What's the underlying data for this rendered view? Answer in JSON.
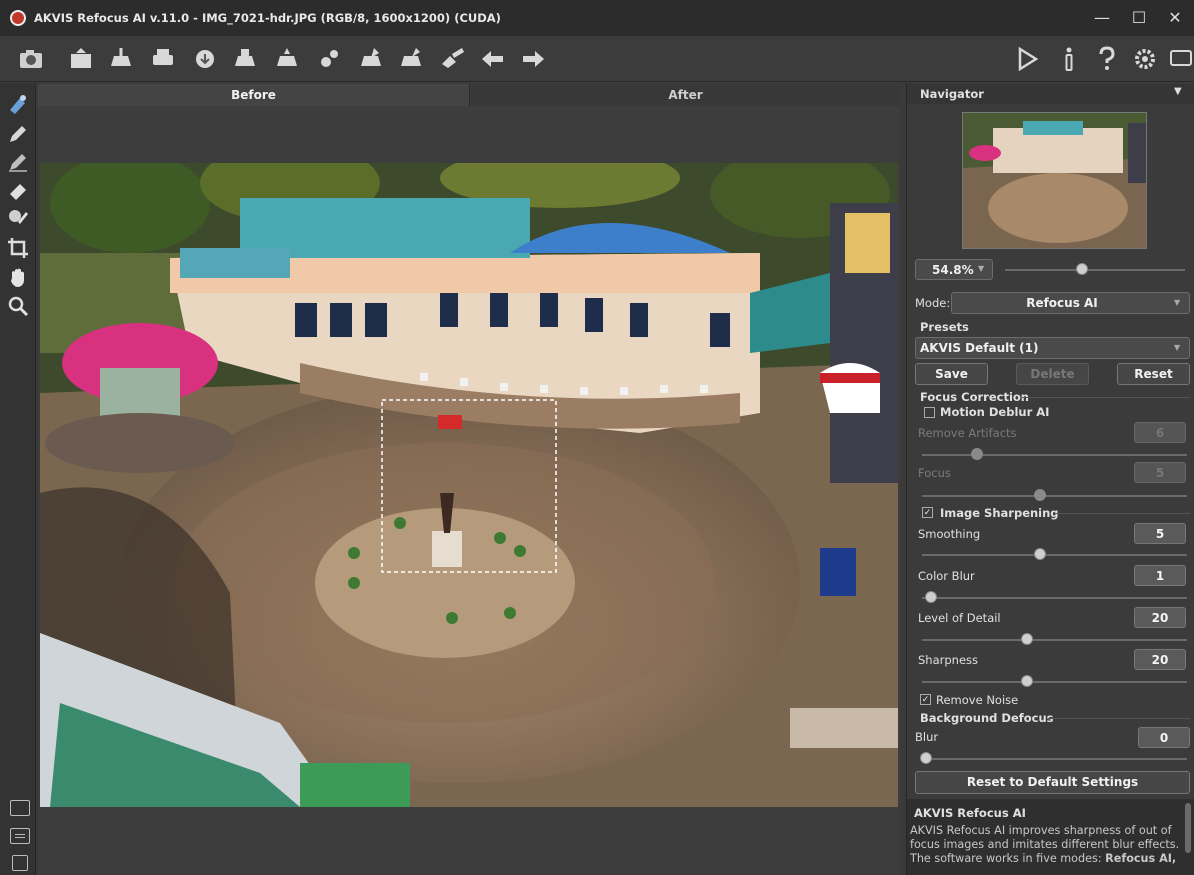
{
  "window": {
    "title": "AKVIS Refocus AI v.11.0 - IMG_7021-hdr.JPG (RGB/8, 1600x1200) (CUDA)",
    "minimize": "—",
    "maximize": "☐",
    "close": "✕"
  },
  "toolbar": {
    "icons": [
      "camera-icon",
      "open-icon",
      "save-icon",
      "print-icon",
      "share-icon",
      "batch-icon",
      "plugin-icon",
      "settings-gear-icon",
      "upload-icon",
      "export-icon",
      "brush-icon",
      "undo-icon",
      "redo-icon"
    ],
    "right_icons": [
      "run-icon",
      "info-icon",
      "help-icon",
      "gear-icon",
      "message-icon"
    ]
  },
  "tabs": {
    "before": "Before",
    "after": "After"
  },
  "navigator": {
    "title": "Navigator",
    "zoom": "54.8%",
    "zoom_level": 0.42
  },
  "mode": {
    "label": "Mode:",
    "value": "Refocus AI"
  },
  "presets": {
    "title": "Presets",
    "selected": "AKVIS Default (1)",
    "save": "Save",
    "delete": "Delete",
    "reset": "Reset"
  },
  "focus_correction": {
    "title": "Focus Correction",
    "motion_deblur": {
      "label": "Motion Deblur AI",
      "checked": false
    },
    "remove_artifacts": {
      "label": "Remove Artifacts",
      "value": "6",
      "level": 0.2
    },
    "focus": {
      "label": "Focus",
      "value": "5",
      "level": 0.45
    }
  },
  "image_sharpening": {
    "label": "Image Sharpening",
    "checked": true,
    "smoothing": {
      "label": "Smoothing",
      "value": "5",
      "level": 0.45
    },
    "color_blur": {
      "label": "Color Blur",
      "value": "1",
      "level": 0.02
    },
    "level_of_detail": {
      "label": "Level of Detail",
      "value": "20",
      "level": 0.4
    },
    "sharpness": {
      "label": "Sharpness",
      "value": "20",
      "level": 0.4
    }
  },
  "remove_noise": {
    "label": "Remove Noise",
    "checked": true
  },
  "background_defocus": {
    "title": "Background Defocus",
    "blur": {
      "label": "Blur",
      "value": "0",
      "level": 0.0
    }
  },
  "reset_defaults": "Reset to Default Settings",
  "help": {
    "title": "AKVIS Refocus AI",
    "text": "AKVIS Refocus AI improves sharpness of out of focus images and imitates different blur effects. The software works in five modes:",
    "text_bold": "Refocus AI,"
  }
}
